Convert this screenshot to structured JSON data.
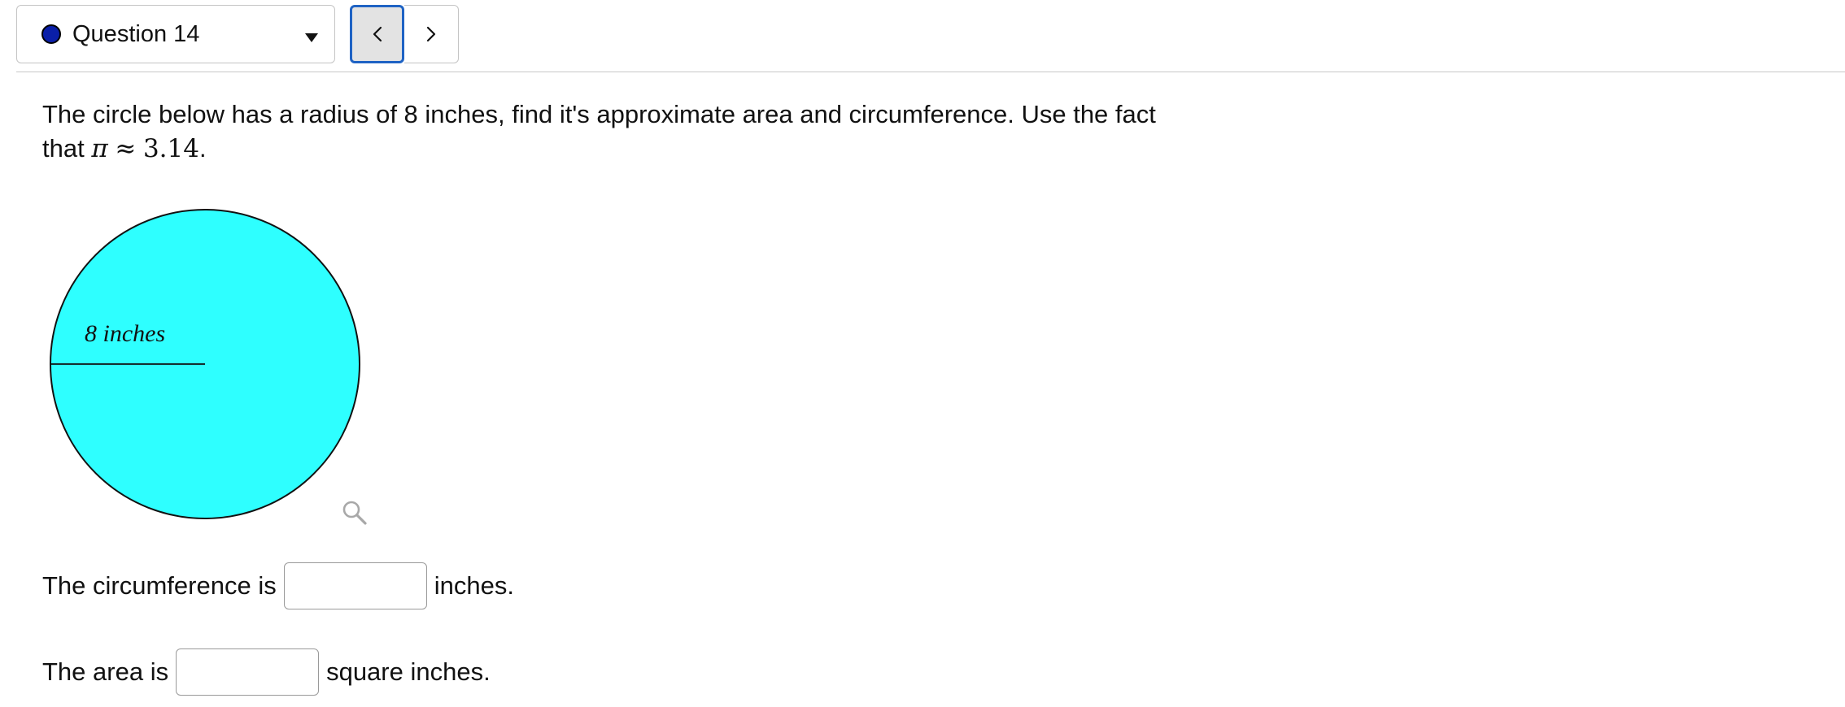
{
  "header": {
    "question_label": "Question 14",
    "status_color": "#0a1fa8",
    "prev_icon": "chevron-left-icon",
    "next_icon": "chevron-right-icon",
    "select_icon": "caret-down-icon"
  },
  "question": {
    "text_line1": "The circle below has a radius of 8 inches, find it's approximate area and circumference. Use the fact",
    "text_line2_prefix": "that",
    "pi_symbol": "π",
    "approx_symbol": "≈",
    "pi_value": "3.14",
    "period": "."
  },
  "figure": {
    "radius_label": "8 inches",
    "fill_color": "#2effff",
    "zoom_icon": "magnifier-icon"
  },
  "answers": {
    "circumference": {
      "prefix": "The circumference is",
      "value": "",
      "suffix": "inches."
    },
    "area": {
      "prefix": "The area is",
      "value": "",
      "suffix": "square inches."
    }
  }
}
